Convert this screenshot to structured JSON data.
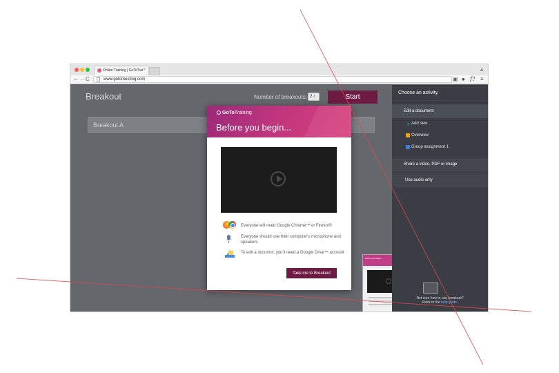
{
  "browser": {
    "tab_title": "Online Training | GoToTrai",
    "tab_close": "×",
    "url": "www.gotomeeting.com",
    "nav": {
      "back": "←",
      "forward": "→",
      "reload": "C"
    },
    "extensions": {
      "func_label": "f?"
    }
  },
  "page": {
    "heading": "Breakout",
    "number_label": "Number of breakouts:",
    "number_value": "2 ↕",
    "start_label": "Start",
    "breakout_rows": [
      "Breakout A"
    ]
  },
  "sidebar": {
    "title": "Choose an activity.",
    "edit_label": "Edit a document",
    "sub_items": [
      {
        "label": "Add new",
        "icon": "plus-icon"
      },
      {
        "label": "Overview",
        "icon": "slides-icon"
      },
      {
        "label": "Group assignment 1",
        "icon": "document-icon"
      }
    ],
    "share_label": "Share a video, PDF or image",
    "audio_label": "Use audio only",
    "help_text": "Not sure how to use breakout?",
    "help_refer": "Refer to the",
    "help_link": "help guide."
  },
  "modal": {
    "logo_prefix": "GoTo",
    "logo_suffix": "Training",
    "title": "Before you begin...",
    "requirements": [
      "Everyone will need Google Chrome™ or Firefox®",
      "Everyone should use their computer's microphone and speakers.",
      "To edit a documnt, you'll need a  Google Drive™ account"
    ],
    "cta_label": "Take me to Breakout"
  },
  "colors": {
    "accent": "#6d1b43",
    "modal_header": "#c2367e",
    "sidebar_bg": "#3a3d43",
    "annotation_line": "#e0474c"
  }
}
